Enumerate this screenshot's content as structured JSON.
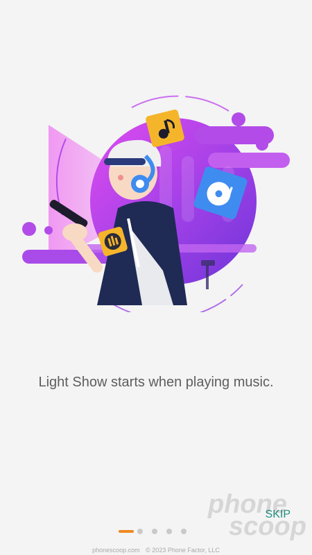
{
  "onboarding": {
    "caption": "Light Show starts when playing music.",
    "skip_label": "SKIP",
    "page_indicator": {
      "total": 5,
      "active": 1
    }
  },
  "illustration": {
    "name": "person-with-headphones-using-phone",
    "icons": [
      "music-note-icon",
      "vinyl-music-icon",
      "equalizer-app-icon"
    ],
    "colors": {
      "primary": "#b24be8",
      "accent": "#f5b52b",
      "tile": "#3f8cf0"
    }
  },
  "watermark": {
    "brand_line1": "phone",
    "brand_line2": "scoop",
    "site": "phonescoop.com",
    "copyright": "© 2023 Phone Factor, LLC"
  }
}
